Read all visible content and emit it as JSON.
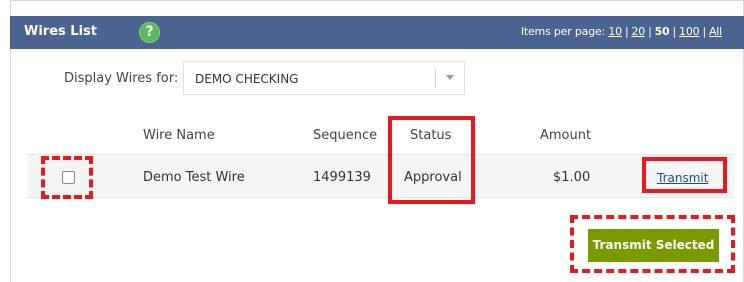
{
  "header": {
    "title": "Wires List",
    "help_icon": "help-icon",
    "items_per_page_label": "Items per page:",
    "page_sizes": [
      "10",
      "20",
      "50",
      "100",
      "All"
    ],
    "current_page_size": "50"
  },
  "filter": {
    "label": "Display Wires for:",
    "selected": "DEMO CHECKING"
  },
  "table": {
    "columns": [
      "Wire Name",
      "Sequence",
      "Status",
      "Amount"
    ],
    "rows": [
      {
        "wire_name": "Demo Test Wire",
        "sequence": "1499139",
        "status": "Approval",
        "amount": "$1.00",
        "action": "Transmit"
      }
    ]
  },
  "actions": {
    "transmit_selected": "Transmit Selected"
  },
  "colors": {
    "header_bg": "#4a6391",
    "button_bg": "#7a9a00",
    "highlight": "#e8191e",
    "help_icon": "#5cb85c"
  }
}
